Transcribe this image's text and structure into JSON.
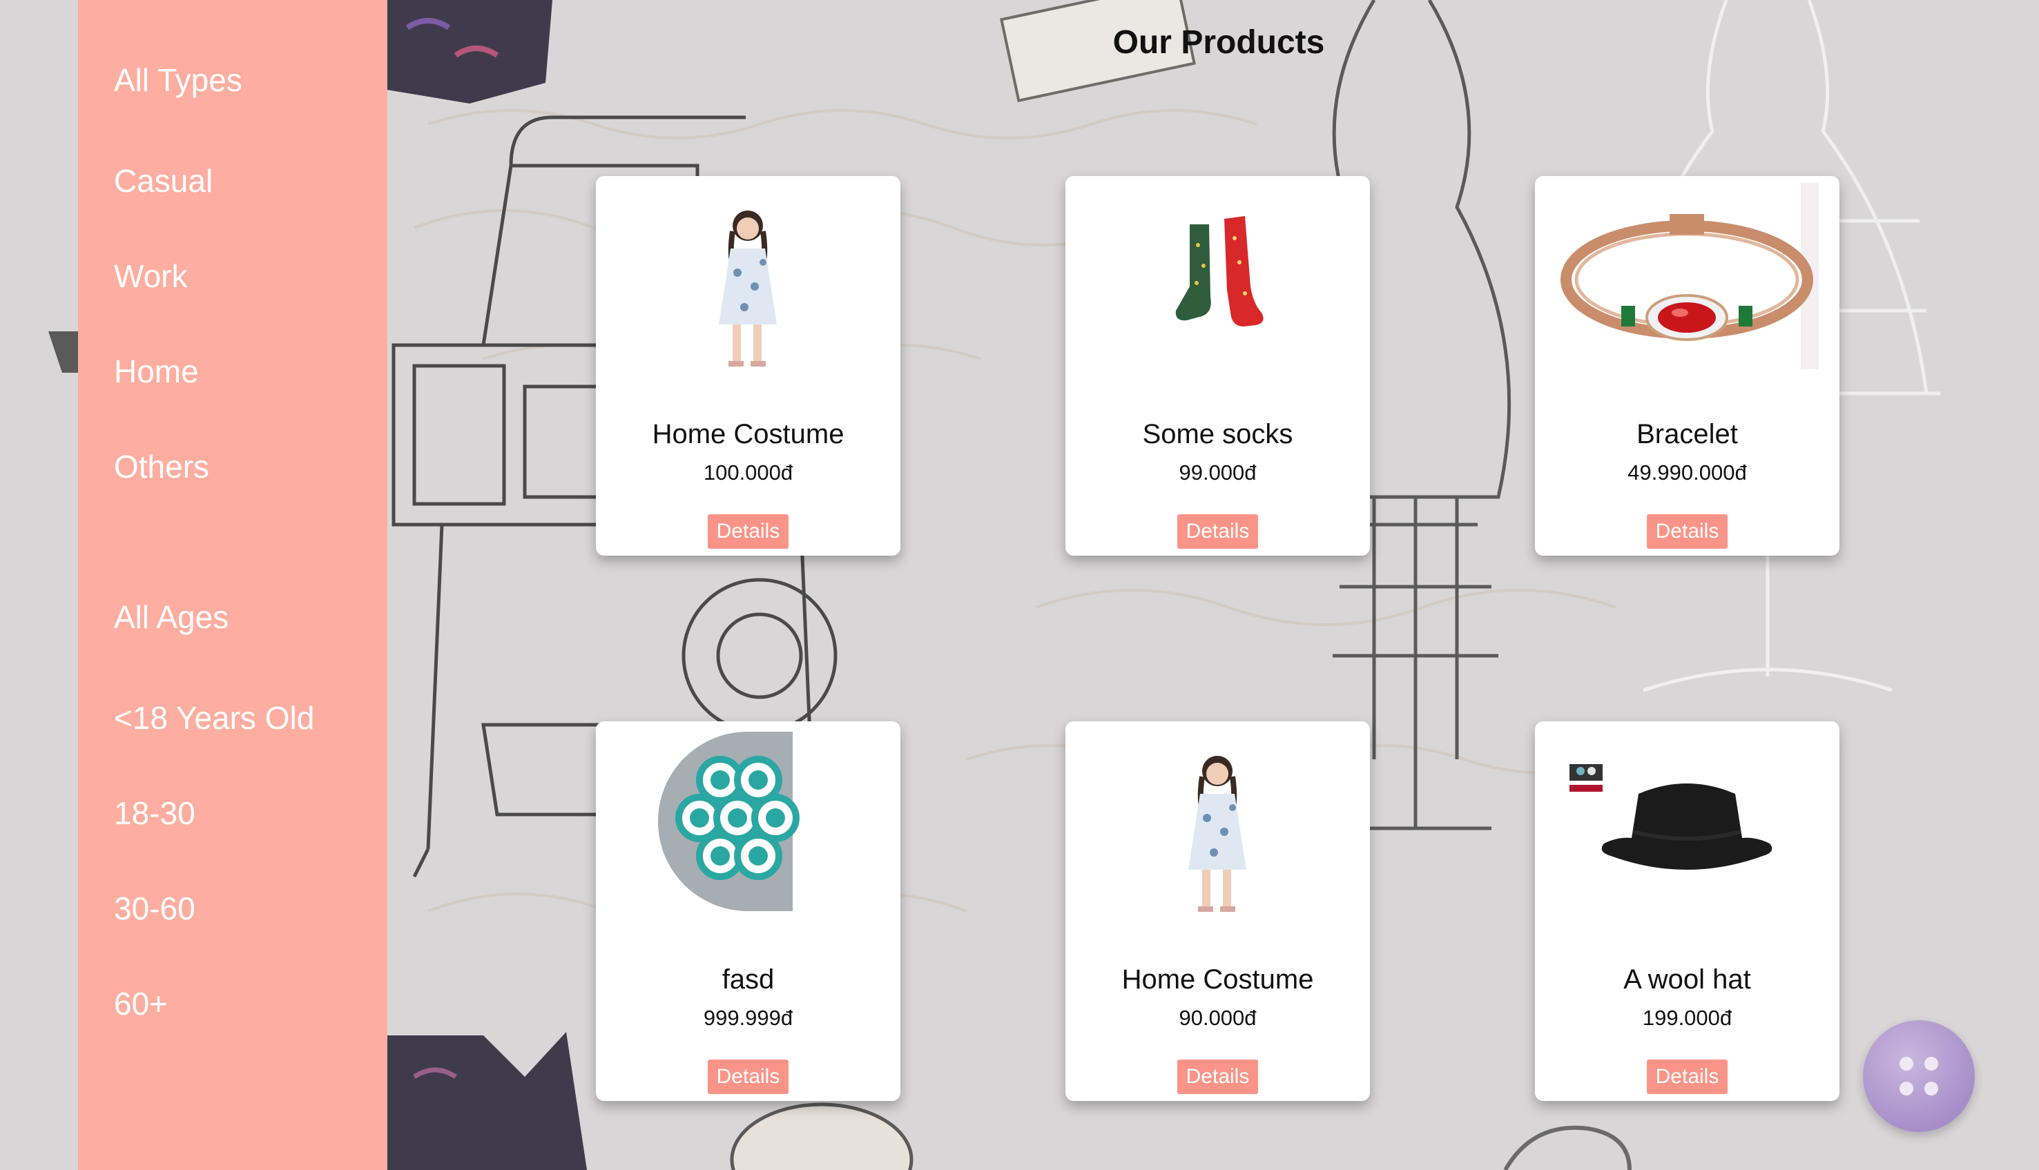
{
  "page": {
    "title": "Our Products"
  },
  "sidebar": {
    "type_filters": [
      "All Types",
      "Casual",
      "Work",
      "Home",
      "Others"
    ],
    "age_filters": [
      "All Ages",
      "<18 Years Old",
      "18-30",
      "30-60",
      "60+"
    ]
  },
  "products": [
    {
      "name": "Home Costume",
      "price": "100.000đ",
      "button": "Details",
      "image": "woman-in-floral-dress"
    },
    {
      "name": "Some socks",
      "price": "99.000đ",
      "button": "Details",
      "image": "green-and-red-socks"
    },
    {
      "name": "Bracelet",
      "price": "49.990.000đ",
      "button": "Details",
      "image": "red-gem-bracelet"
    },
    {
      "name": "fasd",
      "price": "999.999đ",
      "button": "Details",
      "image": "teal-circles-logo"
    },
    {
      "name": "Home Costume",
      "price": "90.000đ",
      "button": "Details",
      "image": "woman-in-floral-dress"
    },
    {
      "name": "A wool hat",
      "price": "199.000đ",
      "button": "Details",
      "image": "black-wool-hat"
    }
  ],
  "fab": {
    "icon": "button-icon"
  },
  "colors": {
    "sidebar": "#fdaea0",
    "accent_button": "#fb9488",
    "background": "#d9d6d8"
  }
}
